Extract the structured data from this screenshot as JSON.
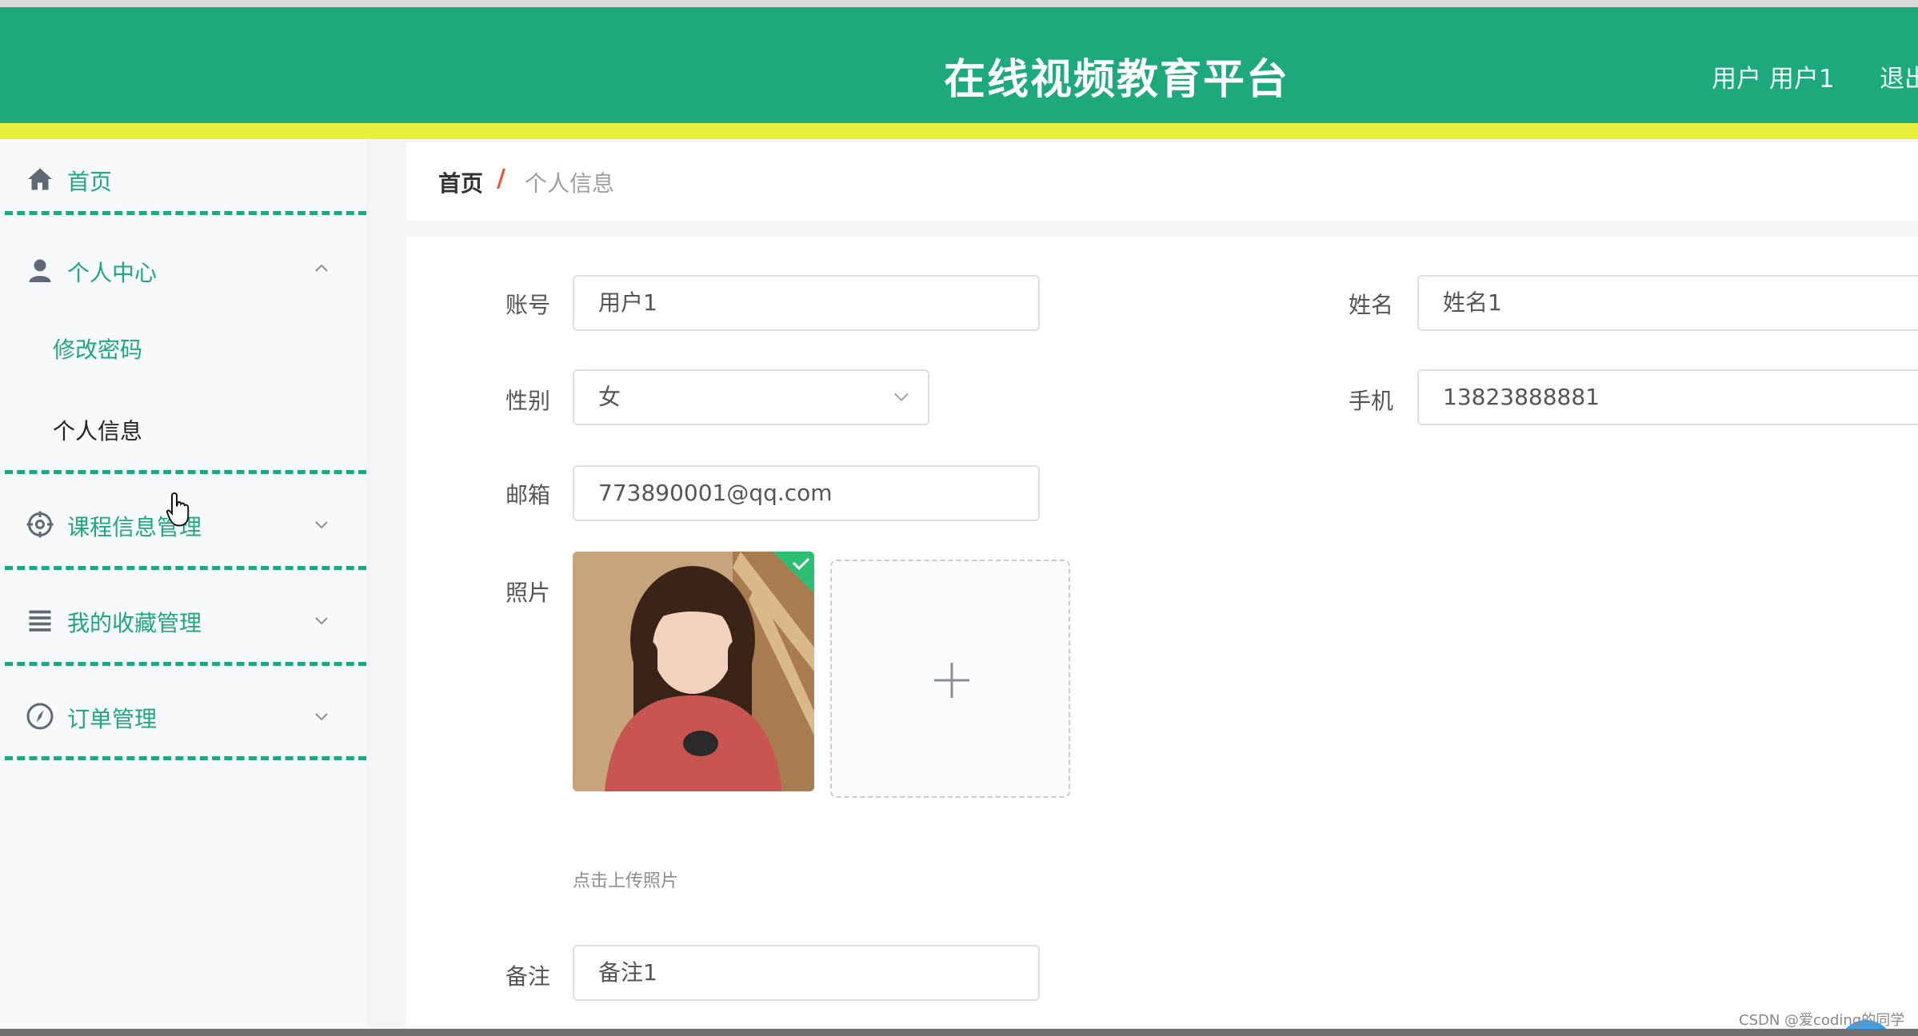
{
  "header": {
    "title": "在线视频教育平台",
    "user_info": "用户 用户1",
    "logout_partial": "退出"
  },
  "sidebar": {
    "items": [
      {
        "label": "首页",
        "icon": "home-icon"
      },
      {
        "label": "个人中心",
        "icon": "user-icon",
        "expanded": true,
        "children": [
          {
            "label": "修改密码",
            "active": false
          },
          {
            "label": "个人信息",
            "active": true
          }
        ]
      },
      {
        "label": "课程信息管理",
        "icon": "target-icon"
      },
      {
        "label": "我的收藏管理",
        "icon": "list-icon"
      },
      {
        "label": "订单管理",
        "icon": "compass-icon"
      }
    ]
  },
  "breadcrumb": {
    "home": "首页",
    "separator": "/",
    "current": "个人信息"
  },
  "form": {
    "account_label": "账号",
    "account_value": "用户1",
    "name_label": "姓名",
    "name_value": "姓名1",
    "gender_label": "性别",
    "gender_value": "女",
    "phone_label": "手机",
    "phone_value": "13823888881",
    "email_label": "邮箱",
    "email_value": "773890001@qq.com",
    "photo_label": "照片",
    "upload_hint": "点击上传照片",
    "remark_label": "备注",
    "remark_value": "备注1"
  },
  "watermark": "CSDN @爱coding的同学",
  "colors": {
    "header": "#1ea97c",
    "accent_bar": "#e8ee3a",
    "menu_text": "#1ea97c",
    "breadcrumb_separator": "#e05a3a"
  }
}
